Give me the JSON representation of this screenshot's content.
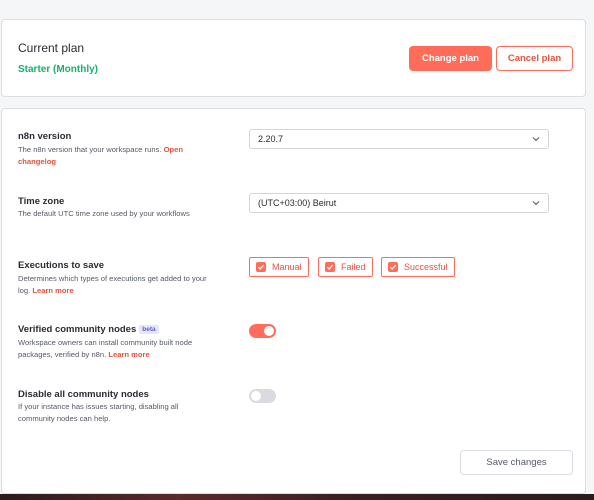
{
  "plan": {
    "title": "Current plan",
    "name": "Starter (Monthly)",
    "change_label": "Change plan",
    "cancel_label": "Cancel plan"
  },
  "settings": {
    "version": {
      "title": "n8n version",
      "desc": "The n8n version that your workspace runs.",
      "link": "Open changelog",
      "value": "2.20.7"
    },
    "timezone": {
      "title": "Time zone",
      "desc": "The default UTC time zone used by your workflows",
      "value": "(UTC+03:00) Beirut"
    },
    "executions": {
      "title": "Executions to save",
      "desc": "Determines which types of executions get added to your log.",
      "link": "Learn more",
      "options": [
        {
          "label": "Manual",
          "checked": true
        },
        {
          "label": "Failed",
          "checked": true
        },
        {
          "label": "Successful",
          "checked": true
        }
      ]
    },
    "verified": {
      "title": "Verified community nodes",
      "badge": "beta",
      "desc": "Workspace owners can install community built node packages, verified by n8n.",
      "link": "Learn more",
      "enabled": true
    },
    "disable_all": {
      "title": "Disable all community nodes",
      "desc": "If your instance has issues starting, disabling all community nodes can help.",
      "enabled": false
    },
    "save_label": "Save changes"
  },
  "colors": {
    "accent": "#ff6d5a",
    "plan_green": "#17b26a"
  },
  "icons": {
    "select_arrow": "chevron-down-icon",
    "check": "check-icon"
  }
}
